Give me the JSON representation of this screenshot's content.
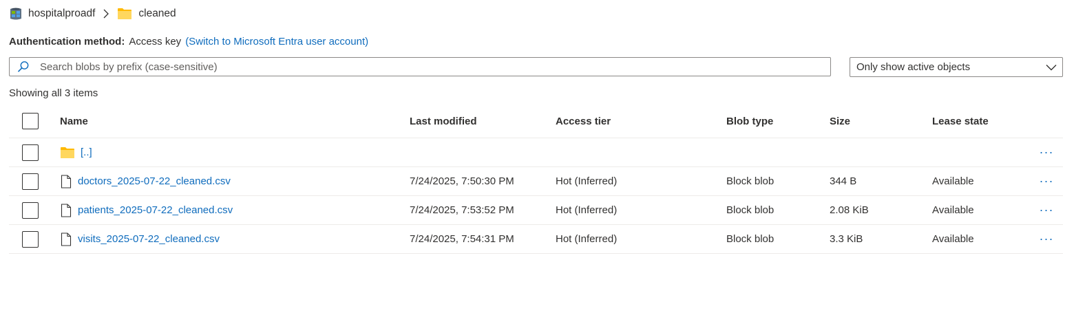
{
  "breadcrumb": {
    "account": "hospitalproadf",
    "container": "cleaned"
  },
  "auth": {
    "label": "Authentication method:",
    "value": "Access key",
    "switch_link": "(Switch to Microsoft Entra user account)"
  },
  "search": {
    "placeholder": "Search blobs by prefix (case-sensitive)",
    "value": ""
  },
  "filter": {
    "selected": "Only show active objects"
  },
  "status": {
    "count_text": "Showing all 3 items"
  },
  "table": {
    "columns": [
      "Name",
      "Last modified",
      "Access tier",
      "Blob type",
      "Size",
      "Lease state"
    ],
    "parent": {
      "name": "[..]"
    },
    "rows": [
      {
        "name": "doctors_2025-07-22_cleaned.csv",
        "modified": "7/24/2025, 7:50:30 PM",
        "tier": "Hot (Inferred)",
        "type": "Block blob",
        "size": "344 B",
        "lease": "Available"
      },
      {
        "name": "patients_2025-07-22_cleaned.csv",
        "modified": "7/24/2025, 7:53:52 PM",
        "tier": "Hot (Inferred)",
        "type": "Block blob",
        "size": "2.08 KiB",
        "lease": "Available"
      },
      {
        "name": "visits_2025-07-22_cleaned.csv",
        "modified": "7/24/2025, 7:54:31 PM",
        "tier": "Hot (Inferred)",
        "type": "Block blob",
        "size": "3.3 KiB",
        "lease": "Available"
      }
    ],
    "more_label": "···"
  },
  "colors": {
    "link": "#0f6cbd",
    "folder": "#ffc83d",
    "border": "#8a8886"
  },
  "icons": {
    "storage": "storage-account-icon",
    "folder": "folder-icon",
    "file": "file-icon",
    "search": "search-icon",
    "chevron": "chevron-down-icon",
    "breadcrumb_separator": "chevron-right-icon"
  }
}
